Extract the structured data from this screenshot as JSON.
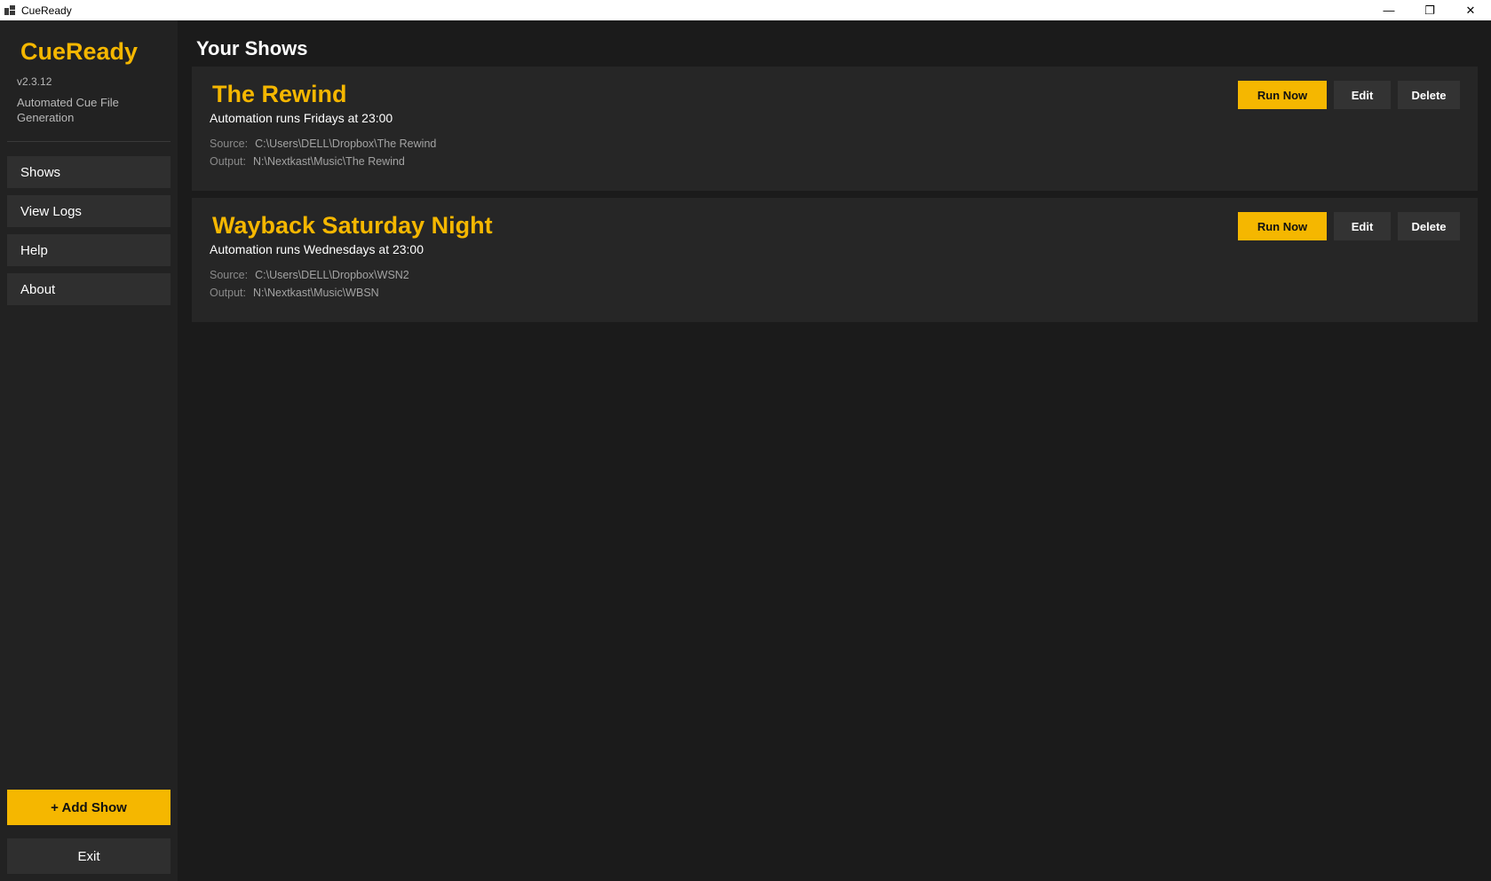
{
  "window": {
    "title": "CueReady",
    "controls": {
      "minimize": "—",
      "restore": "❐",
      "close": "✕"
    }
  },
  "sidebar": {
    "brand": "CueReady",
    "version": "v2.3.12",
    "tagline": "Automated Cue File Generation",
    "nav": [
      {
        "label": "Shows"
      },
      {
        "label": "View Logs"
      },
      {
        "label": "Help"
      },
      {
        "label": "About"
      }
    ],
    "add_show": "+ Add Show",
    "exit": "Exit"
  },
  "main": {
    "title": "Your Shows",
    "actions": {
      "run": "Run Now",
      "edit": "Edit",
      "delete": "Delete"
    },
    "source_label": "Source:",
    "output_label": "Output:",
    "shows": [
      {
        "name": "The Rewind",
        "schedule": "Automation runs Fridays at 23:00",
        "source": "C:\\Users\\DELL\\Dropbox\\The Rewind",
        "output": "N:\\Nextkast\\Music\\The Rewind"
      },
      {
        "name": "Wayback Saturday Night",
        "schedule": "Automation runs Wednesdays at 23:00",
        "source": "C:\\Users\\DELL\\Dropbox\\WSN2",
        "output": "N:\\Nextkast\\Music\\WBSN"
      }
    ]
  },
  "colors": {
    "accent": "#f5b700",
    "background": "#1b1b1b",
    "sidebar": "#222222",
    "card": "#262626"
  }
}
